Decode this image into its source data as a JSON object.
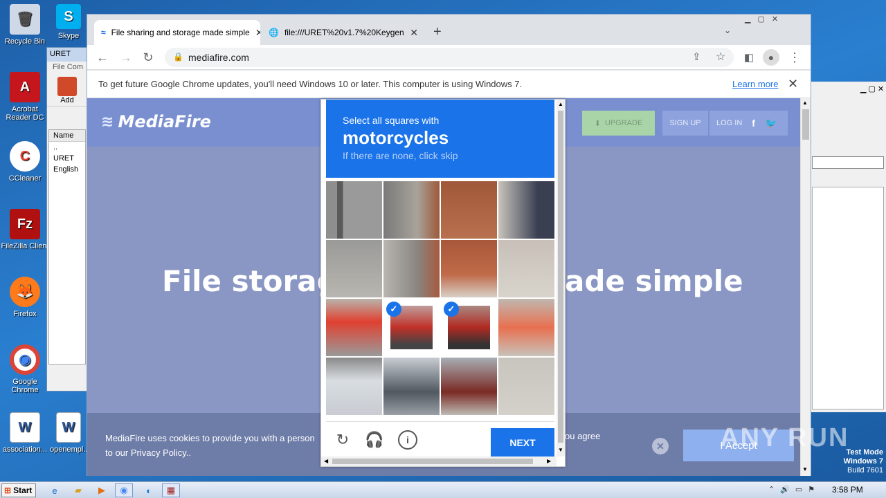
{
  "desktop": {
    "icons": [
      {
        "label": "Recycle Bin",
        "glyph": "🗑",
        "color": "#cfd8e6"
      },
      {
        "label": "Acrobat Reader DC",
        "glyph": "A",
        "color": "#c4161c"
      },
      {
        "label": "CCleaner",
        "glyph": "C",
        "color": "#e04030"
      },
      {
        "label": "FileZilla Client",
        "glyph": "Fz",
        "color": "#b01010"
      },
      {
        "label": "Firefox",
        "glyph": "🦊",
        "color": "#ff7a1a"
      },
      {
        "label": "Google Chrome",
        "glyph": "◉",
        "color": "#4285f4"
      },
      {
        "label": "association...",
        "glyph": "W",
        "color": "#2b579a"
      },
      {
        "label": "openempl...",
        "glyph": "W",
        "color": "#2b579a"
      },
      {
        "label": "Skype",
        "glyph": "S",
        "color": "#00aff0"
      }
    ]
  },
  "rar_window": {
    "title": "URET",
    "menu": "File  Com",
    "add_label": "Add",
    "column_name": "Name",
    "items": [
      "..",
      "URET",
      "English"
    ]
  },
  "chrome": {
    "tabs": [
      {
        "title": "File sharing and storage made simple",
        "active": true
      },
      {
        "title": "file:///URET%20v1.7%20Keygen%...",
        "active": false
      }
    ],
    "new_tab": "+",
    "url": "mediafire.com",
    "infobar": {
      "text": "To get future Google Chrome updates, you'll need Windows 10 or later. This computer is using Windows 7.",
      "link": "Learn more"
    }
  },
  "mediafire": {
    "logo": "MediaFire",
    "upgrade": "UPGRADE",
    "signup": "SIGN UP",
    "login": "LOG IN",
    "hero_left": "File storag",
    "hero_right": "ade simple",
    "cookie_text": "MediaFire uses cookies to provide you with a person",
    "cookie_text_line2": "to our Privacy Policy..",
    "cookie_text_right": "ou agree",
    "accept": "I Accept"
  },
  "captcha": {
    "instruction": "Select all squares with",
    "target": "motorcycles",
    "hint": "If there are none, click skip",
    "selected_cells": [
      9,
      10
    ],
    "next": "NEXT",
    "colors": {
      "accent": "#1a73e8"
    }
  },
  "taskbar": {
    "start": "Start",
    "clock": "3:58 PM"
  },
  "watermark": "ANY RUN",
  "testmode": [
    "Test Mode",
    "Windows 7",
    "Build 7601"
  ]
}
